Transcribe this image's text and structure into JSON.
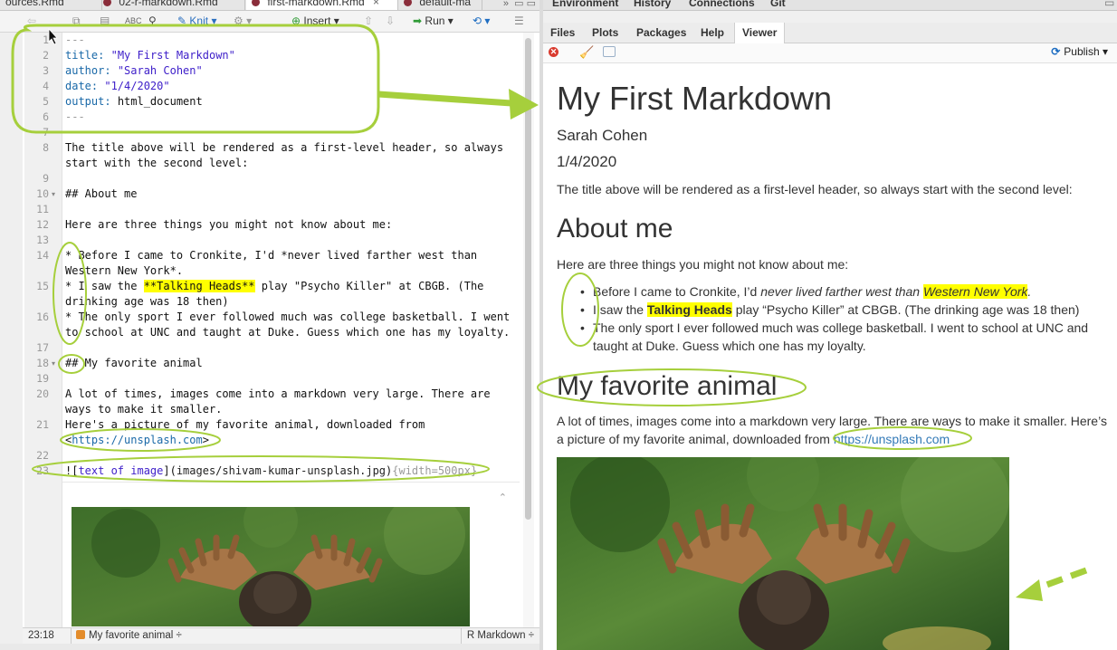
{
  "editor": {
    "tabs": [
      {
        "label": "ources.Rmd"
      },
      {
        "label": "02-r-markdown.Rmd"
      },
      {
        "label": "first-markdown.Rmd"
      },
      {
        "label": "default-ma"
      }
    ],
    "tab_overflow": "»",
    "toolbar": {
      "knit": "Knit",
      "insert": "Insert",
      "run": "Run"
    },
    "line_numbers": [
      "1",
      "2",
      "3",
      "4",
      "5",
      "6",
      "7",
      "8",
      "9",
      "10",
      "11",
      "12",
      "13",
      "14",
      "15",
      "16",
      "17",
      "18",
      "19",
      "20",
      "21",
      "22",
      "23"
    ],
    "lines": {
      "l1": "---",
      "l2_key": "title:",
      "l2_val": "\"My First Markdown\"",
      "l3_key": "author:",
      "l3_val": "\"Sarah Cohen\"",
      "l4_key": "date:",
      "l4_val": "\"1/4/2020\"",
      "l5_key": "output:",
      "l5_val": "html_document",
      "l6": "---",
      "l8a": "The title above will be rendered as a first-level header, so always",
      "l8b": "start with the second level:",
      "l10": "## About me",
      "l12": "Here are three things you might not know about me:",
      "l14a": "* Before I came to Cronkite, I'd *never lived farther west than",
      "l14b": "Western New York*.",
      "l15a_pre": "* I saw the ",
      "l15a_hl": "**Talking Heads**",
      "l15a_post": " play \"Psycho Killer\" at CBGB. (The",
      "l15b": "drinking age was 18 then)",
      "l16a": "* The only sport I ever followed much was college basketball. I went",
      "l16b": "to school at UNC and taught at Duke. Guess which one has my loyalty.",
      "l18": "## My favorite animal",
      "l20a": "A lot of times, images come into a markdown very large. There are",
      "l20b": "ways to make it smaller.",
      "l21a": "Here's a picture of my favorite animal, downloaded from",
      "l21b_open": "<",
      "l21b_url": "https://unsplash.com",
      "l21b_close": ">",
      "l23_a": "![",
      "l23_alt": "text of image",
      "l23_b": "](",
      "l23_path": "images/shivam-kumar-unsplash.jpg",
      "l23_c": ")",
      "l23_attr": "{width=500px}"
    },
    "status": {
      "position": "23:18",
      "section": "My favorite animal",
      "section_arrow": "÷",
      "mode": "R Markdown",
      "mode_arrow": "÷"
    }
  },
  "top_tabs": [
    "Environment",
    "History",
    "Connections",
    "Git"
  ],
  "viewer": {
    "tabs": [
      "Files",
      "Plots",
      "Packages",
      "Help",
      "Viewer"
    ],
    "publish": "Publish",
    "doc": {
      "title": "My First Markdown",
      "author": "Sarah Cohen",
      "date": "1/4/2020",
      "intro": "The title above will be rendered as a first-level header, so always start with the second level:",
      "h2_about": "About me",
      "about_intro": "Here are three things you might not know about me:",
      "b1_pre": "Before I came to Cronkite, I’d ",
      "b1_em": "never lived farther west than ",
      "b1_hl": "Western New York",
      "b1_post": ".",
      "b2_pre": "I saw the ",
      "b2_hl": "Talking Heads",
      "b2_post": " play “Psycho Killer” at CBGB. (The drinking age was 18 then)",
      "b3": "The only sport I ever followed much was college basketball. I went to school at UNC and taught at Duke. Guess which one has my loyalty.",
      "h2_animal": "My favorite animal",
      "animal_text": "A lot of times, images come into a markdown very large. There are ways to make it smaller. Here’s a picture of my favorite animal, downloaded from ",
      "animal_link": "https://unsplash.com"
    }
  },
  "annotation_color": "#a6cf3c"
}
